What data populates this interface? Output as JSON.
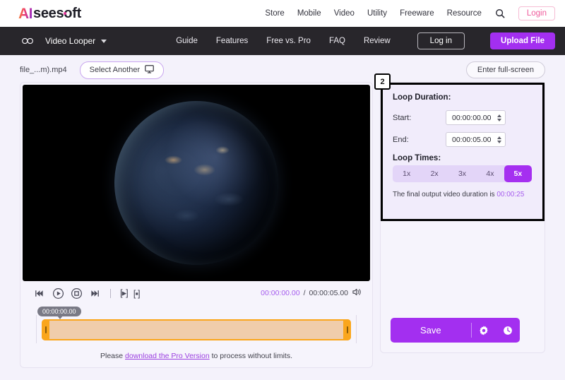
{
  "topbar": {
    "logo": {
      "ai": "AI",
      "rest": "seesoft"
    },
    "nav": [
      {
        "label": "Store"
      },
      {
        "label": "Mobile"
      },
      {
        "label": "Video"
      },
      {
        "label": "Utility"
      },
      {
        "label": "Freeware"
      },
      {
        "label": "Resource"
      }
    ],
    "search_icon": "search-icon",
    "login_label": "Login"
  },
  "darknav": {
    "loop_icon": "infinity-loop-icon",
    "product": "Video Looper",
    "links": [
      {
        "label": "Guide"
      },
      {
        "label": "Features"
      },
      {
        "label": "Free vs. Pro"
      },
      {
        "label": "FAQ"
      },
      {
        "label": "Review"
      }
    ],
    "login_label": "Log in",
    "upload_label": "Upload File"
  },
  "filerow": {
    "filename": "file_...m).mp4",
    "select_another_label": "Select Another",
    "monitor_icon": "monitor-icon",
    "fullscreen_label": "Enter full-screen"
  },
  "player": {
    "controls": [
      {
        "name": "prev-frame-icon"
      },
      {
        "name": "play-icon"
      },
      {
        "name": "stop-icon"
      },
      {
        "name": "next-frame-icon"
      },
      {
        "name": "set-start-icon",
        "label": "[▸]"
      },
      {
        "name": "set-end-icon",
        "label": "[▪]"
      }
    ],
    "current_time": "00:00:00.00",
    "separator": "/",
    "total_time": "00:00:05.00",
    "volume_icon": "volume-icon",
    "timeline_tooltip": "00:00:00.00",
    "pro_note_pre": "Please ",
    "pro_note_link": "download the Pro Version",
    "pro_note_post": " to process without limits."
  },
  "settings": {
    "badge": "2",
    "loop_duration_title": "Loop Duration:",
    "start_label": "Start:",
    "start_value": "00:00:00.00",
    "end_label": "End:",
    "end_value": "00:00:05.00",
    "loop_times_title": "Loop Times:",
    "loop_options": [
      {
        "label": "1x",
        "selected": false
      },
      {
        "label": "2x",
        "selected": false
      },
      {
        "label": "3x",
        "selected": false
      },
      {
        "label": "4x",
        "selected": false
      },
      {
        "label": "5x",
        "selected": true
      }
    ],
    "final_note_pre": "The final output video duration is ",
    "final_duration": "00:00:25"
  },
  "actions": {
    "save_label": "Save",
    "gear_icon": "gear-icon",
    "history_icon": "clock-history-icon"
  },
  "colors": {
    "accent_purple": "#a32ff0",
    "link_pink": "#ef5a9b",
    "timeline_orange": "#faa61c"
  }
}
